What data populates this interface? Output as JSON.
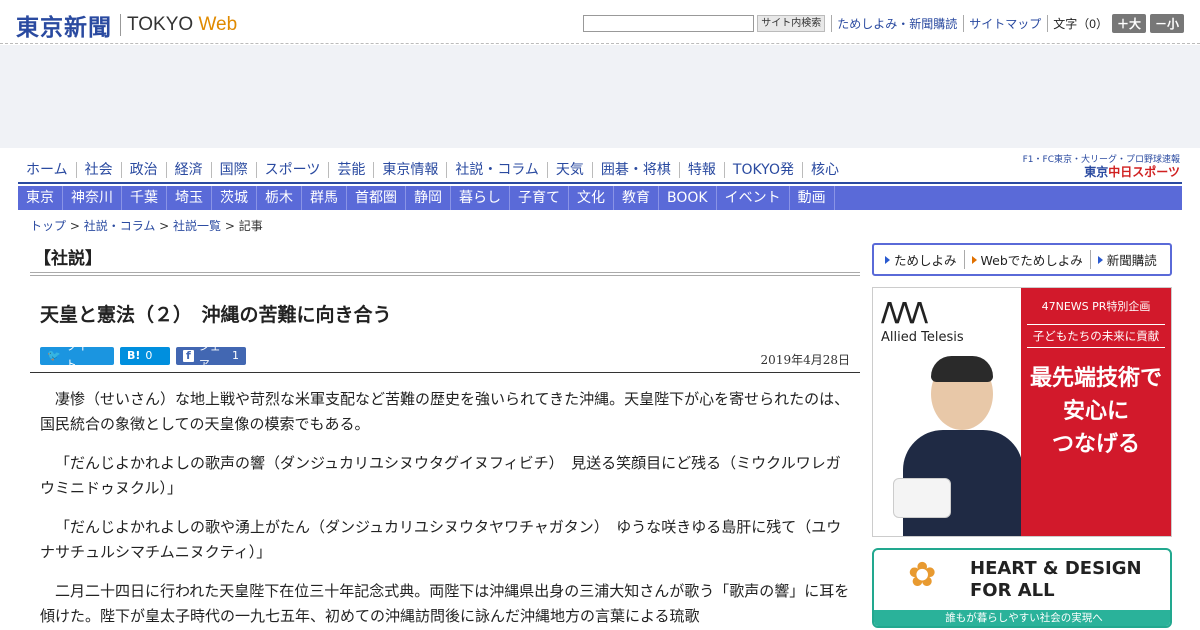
{
  "header": {
    "logo_jp": "東京新聞",
    "logo_en": "TOKYO",
    "logo_web": "Web",
    "search_button": "サイト内検索",
    "links": [
      "ためしよみ・新聞購読",
      "サイトマップ"
    ],
    "font_size_label": "文字（0）",
    "font_larger": "＋大",
    "font_smaller": "－小"
  },
  "main_nav": [
    "ホーム",
    "社会",
    "政治",
    "経済",
    "国際",
    "スポーツ",
    "芸能",
    "東京情報",
    "社説・コラム",
    "天気",
    "囲碁・将棋",
    "特報",
    "TOKYO発",
    "核心"
  ],
  "chunichi": {
    "line1": "F1・FC東京・大リーグ・プロ野球速報",
    "line2_a": "東京",
    "line2_b": "中日スポーツ"
  },
  "region_nav": [
    "東京",
    "神奈川",
    "千葉",
    "埼玉",
    "茨城",
    "栃木",
    "群馬",
    "首都圏",
    "静岡",
    "暮らし",
    "子育て",
    "文化",
    "教育",
    "BOOK",
    "イベント",
    "動画"
  ],
  "breadcrumb": {
    "items": [
      "トップ",
      "社説・コラム",
      "社説一覧"
    ],
    "current": "記事",
    "sep": " > "
  },
  "article": {
    "section": "【社説】",
    "headline": "天皇と憲法（２）　沖縄の苦難に向き合う",
    "share": {
      "tweet_label": "ツイート",
      "hatena_icon": "B!",
      "hatena_count": "0",
      "facebook_label": "シェア",
      "facebook_count": "1"
    },
    "date": "2019年4月28日",
    "paragraphs": [
      "凄惨（せいさん）な地上戦や苛烈な米軍支配など苦難の歴史を強いられてきた沖縄。天皇陛下が心を寄せられたのは、国民統合の象徴としての天皇像の模索でもある。",
      "「だんじよかれよしの歌声の響（ダンジュカリユシヌウタグイヌフィビチ）　見送る笑顔目にど残る（ミウクルワレガウミニドゥヌクル）」",
      "「だんじよかれよしの歌や湧上がたん（ダンジュカリユシヌウタヤワチャガタン）　ゆうな咲きゆる島肝に残て（ユウナサチュルシマチムニヌクティ）」",
      "二月二十四日に行われた天皇陛下在位三十年記念式典。両陛下は沖縄県出身の三浦大知さんが歌う「歌声の響」に耳を傾けた。陛下が皇太子時代の一九七五年、初めての沖縄訪問後に詠んだ沖縄地方の言葉による琉歌"
    ]
  },
  "sidebar": {
    "subscribe": [
      "ためしよみ",
      "Webでためしよみ",
      "新聞購読"
    ],
    "ad1": {
      "logo": "Allied Telesis",
      "pr": "47NEWS PR特別企画",
      "sub": "子どもたちの未来に貢献",
      "big_lines": [
        "最先端技術で",
        "安心に",
        "つなげる"
      ]
    },
    "ad2": {
      "title_lines": [
        "HEART & DESIGN",
        "FOR ALL"
      ],
      "foot": "誰もが暮らしやすい社会の実現へ"
    }
  },
  "colors": {
    "brand_blue": "#2a4aa0",
    "region_nav": "#5a6ad8",
    "ad_red": "#d2192b",
    "ad_green": "#2ab29a"
  }
}
